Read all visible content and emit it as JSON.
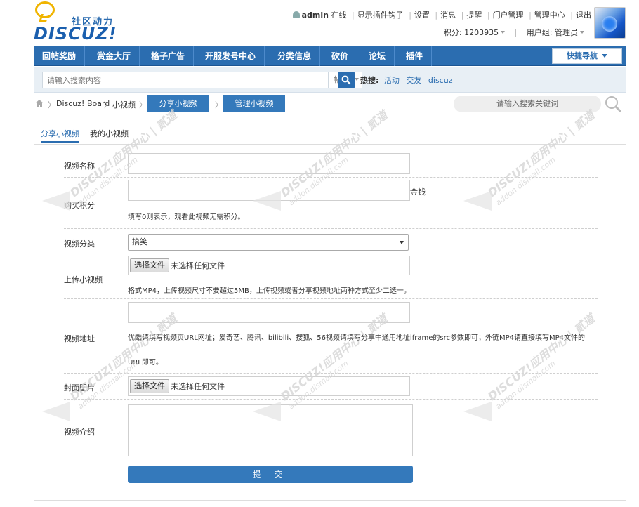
{
  "header": {
    "logo_cn": "社区动力",
    "logo_en": "DISCUZ!",
    "username": "admin",
    "online": "在线",
    "links": [
      "显示插件钩子",
      "设置",
      "消息",
      "提醒",
      "门户管理",
      "管理中心",
      "退出"
    ],
    "score_label": "积分: 1203935",
    "group_label": "用户组: 管理员"
  },
  "nav": {
    "items": [
      "回帖奖励",
      "赏金大厅",
      "格子广告",
      "开服发号中心",
      "分类信息",
      "砍价",
      "论坛",
      "插件"
    ],
    "quick_nav": "快捷导航"
  },
  "search": {
    "placeholder": "请输入搜索内容",
    "type": "帖子",
    "hot_label": "热搜:",
    "hot_keywords": [
      "活动",
      "交友",
      "discuz"
    ]
  },
  "breadcrumb": {
    "items": [
      "Discuz! Board",
      "小视频"
    ],
    "btn_share": "分享小视频",
    "btn_manage": "管理小视频",
    "search_placeholder": "请输入搜索关键词"
  },
  "tabs": [
    "分享小视频",
    "我的小视频"
  ],
  "form": {
    "name_label": "视频名称",
    "price_label": "购买积分",
    "price_unit": "金钱",
    "price_hint": "填写0则表示，观看此视频无需积分。",
    "category_label": "视频分类",
    "category_value": "搞笑",
    "upload_label": "上传小视频",
    "file_button": "选择文件",
    "file_none": "未选择任何文件",
    "upload_hint": "格式MP4，上传视频尺寸不要超过5MB，上传视频或者分享视频地址两种方式至少二选一。",
    "url_label": "视频地址",
    "url_hint_line1": "优酷请填写视频页URL网址；爱奇艺、腾讯、bilibili、搜狐、56视频请填写分享中通用地址iframe的src参数即可；外链MP4请直接填写MP4文件的",
    "url_hint_line2": "URL即可。",
    "cover_label": "封面图片",
    "intro_label": "视频介绍",
    "submit": "提 交"
  },
  "watermark": {
    "line1": "DISCUZ!应用中心 | 贰道",
    "line2": "addon.dismall.com"
  }
}
